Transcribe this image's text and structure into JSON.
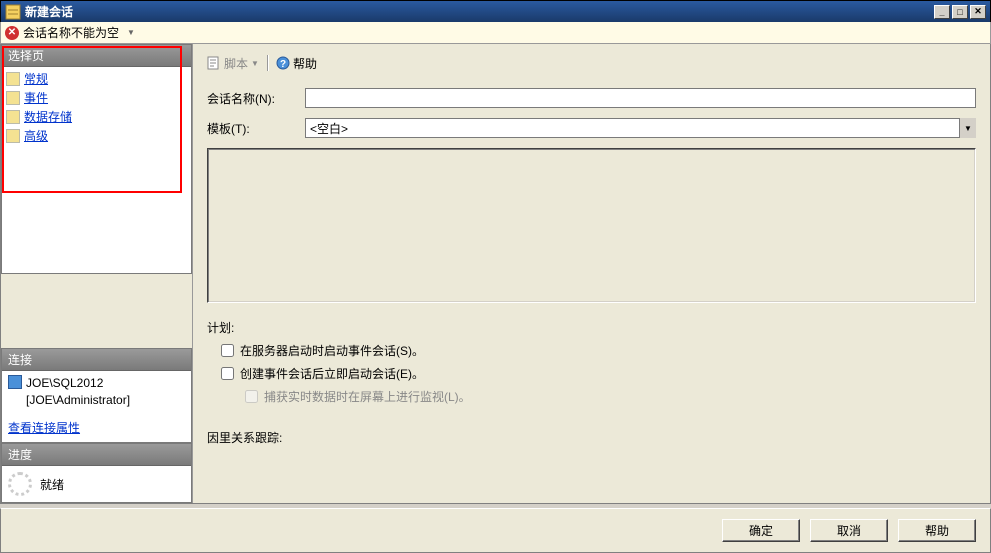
{
  "title": "新建会话",
  "error": "会话名称不能为空",
  "sidebar": {
    "hdr_pages": "选择页",
    "items": [
      "常规",
      "事件",
      "数据存储",
      "高级"
    ],
    "hdr_conn": "连接",
    "server": "JOE\\SQL2012",
    "user": "[JOE\\Administrator]",
    "viewprops": "查看连接属性",
    "hdr_prog": "进度",
    "prog": "就绪"
  },
  "toolbar": {
    "script": "脚本",
    "help": "帮助"
  },
  "form": {
    "session_label": "会话名称(N):",
    "session_value": "",
    "template_label": "模板(T):",
    "template_value": "<空白>",
    "plan_label": "计划:",
    "chk_start": "在服务器启动时启动事件会话(S)。",
    "chk_immediate": "创建事件会话后立即启动会话(E)。",
    "chk_watch": "捕获实时数据时在屏幕上进行监视(L)。",
    "causal": "因里关系跟踪:"
  },
  "buttons": {
    "ok": "确定",
    "cancel": "取消",
    "help": "帮助"
  }
}
